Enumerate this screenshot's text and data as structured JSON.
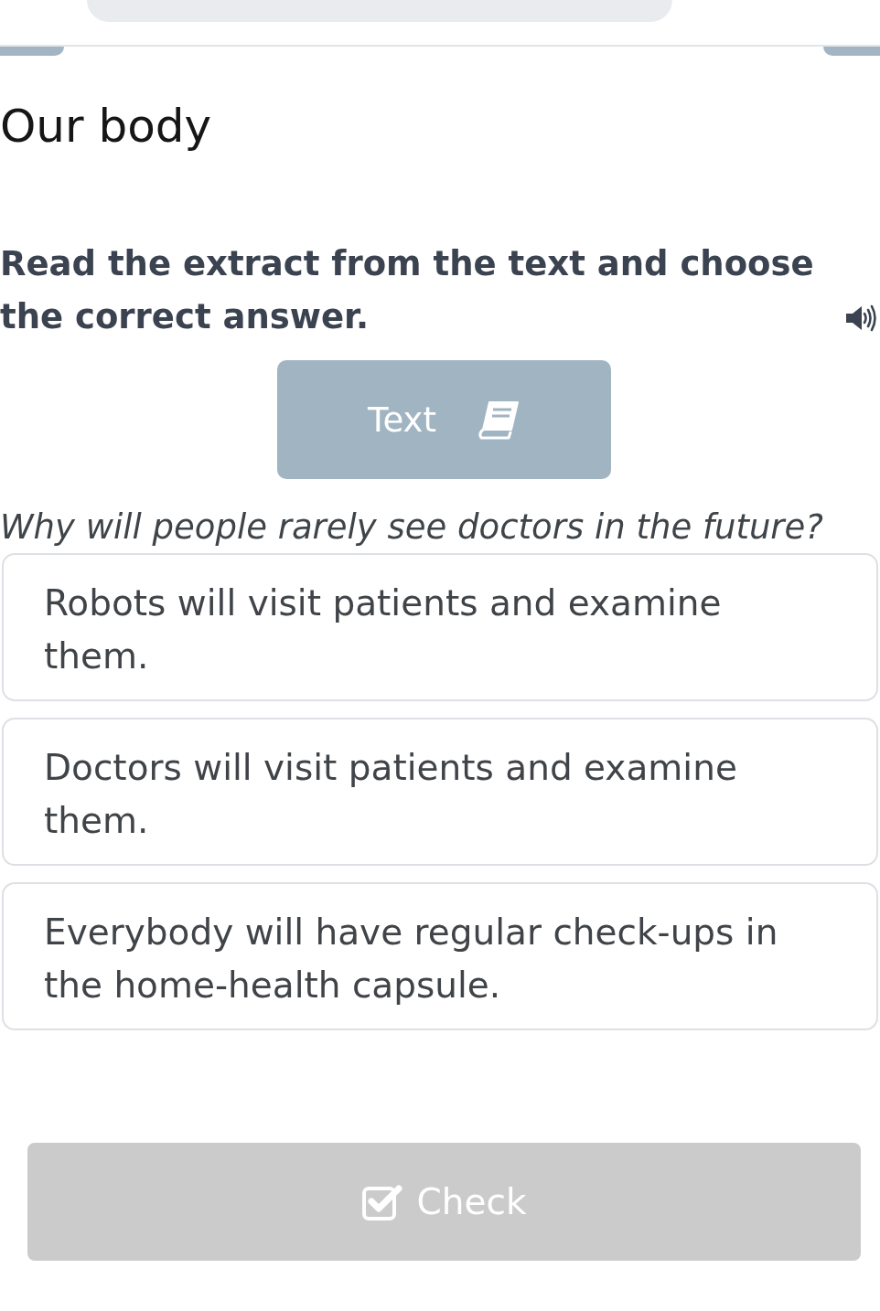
{
  "lesson": {
    "title": "Our body"
  },
  "task": {
    "instruction": "Read the extract from the text and choose the correct answer.",
    "text_button": {
      "label": "Text"
    },
    "question": "Why will people rarely see doctors in the future?"
  },
  "options": [
    {
      "text": "Robots will visit patients and examine them.",
      "selected": false
    },
    {
      "text": "Doctors will visit patients and examine them.",
      "selected": false
    },
    {
      "text": "Everybody will have regular check-ups in the home-health capsule.",
      "selected": false
    }
  ],
  "check_button": {
    "label": "Check",
    "disabled": true
  }
}
